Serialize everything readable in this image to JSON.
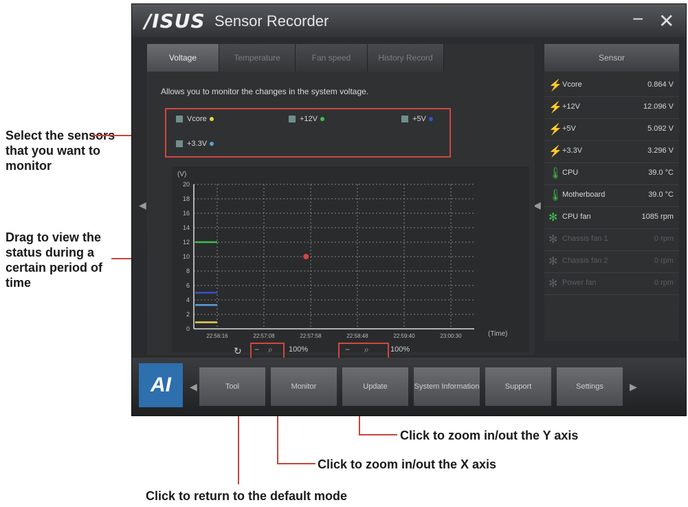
{
  "window": {
    "logo": "/ISUS",
    "title": "Sensor Recorder",
    "minimize": "−",
    "close": "✕"
  },
  "tabs": [
    {
      "label": "Voltage",
      "active": true
    },
    {
      "label": "Temperature",
      "active": false
    },
    {
      "label": "Fan speed",
      "active": false
    },
    {
      "label": "History Record",
      "active": false
    }
  ],
  "description": "Allows you to monitor the changes in the system voltage.",
  "sensor_checks": [
    {
      "label": "Vcore",
      "color": "#e8d24a"
    },
    {
      "label": "+12V",
      "color": "#3fbf4a"
    },
    {
      "label": "+5V",
      "color": "#3355cc"
    },
    {
      "label": "+3.3V",
      "color": "#5aa0d8"
    }
  ],
  "chart_data": {
    "type": "line",
    "ylabel": "(V)",
    "xlabel": "(Time)",
    "ylim": [
      0,
      20
    ],
    "yticks": [
      0,
      2,
      4,
      6,
      8,
      10,
      12,
      14,
      16,
      18,
      20
    ],
    "xticks": [
      "22:56:16",
      "22:57:08",
      "22:57:58",
      "22:58:48",
      "22:59:40",
      "23:00:30"
    ],
    "grid": true,
    "series": [
      {
        "name": "+12V",
        "color": "#3fbf4a",
        "values": [
          12,
          12
        ]
      },
      {
        "name": "+5V",
        "color": "#3355cc",
        "values": [
          5,
          5
        ]
      },
      {
        "name": "+3.3V",
        "color": "#5aa0d8",
        "values": [
          3.3,
          3.3
        ]
      },
      {
        "name": "Vcore",
        "color": "#e8d24a",
        "values": [
          0.9,
          0.9
        ]
      }
    ],
    "marker_value": 10
  },
  "zoom": {
    "reset_icon": "↻",
    "x_zoom_value": "100%",
    "y_zoom_value": "100%"
  },
  "sensor_panel": {
    "header": "Sensor",
    "rows": [
      {
        "name": "Vcore",
        "value": "0.864 V",
        "icon": "⚡",
        "color": "#3fbf4a",
        "dim": false
      },
      {
        "name": "+12V",
        "value": "12.096 V",
        "icon": "⚡",
        "color": "#3fbf4a",
        "dim": false
      },
      {
        "name": "+5V",
        "value": "5.092 V",
        "icon": "⚡",
        "color": "#3fbf4a",
        "dim": false
      },
      {
        "name": "+3.3V",
        "value": "3.296 V",
        "icon": "⚡",
        "color": "#3fbf4a",
        "dim": false
      },
      {
        "name": "CPU",
        "value": "39.0 °C",
        "icon": "🌡",
        "color": "#3fbf4a",
        "dim": false
      },
      {
        "name": "Motherboard",
        "value": "39.0 °C",
        "icon": "🌡",
        "color": "#3fbf4a",
        "dim": false
      },
      {
        "name": "CPU fan",
        "value": "1085 rpm",
        "icon": "✻",
        "color": "#3fbf4a",
        "dim": false
      },
      {
        "name": "Chassis fan 1",
        "value": "0 rpm",
        "icon": "✻",
        "color": "#5c5d60",
        "dim": true
      },
      {
        "name": "Chassis fan 2",
        "value": "0 rpm",
        "icon": "✻",
        "color": "#5c5d60",
        "dim": true
      },
      {
        "name": "Power fan",
        "value": "0 rpm",
        "icon": "✻",
        "color": "#5c5d60",
        "dim": true
      }
    ]
  },
  "bottom_nav": {
    "logo": "AI",
    "items": [
      "Tool",
      "Monitor",
      "Update",
      "System Information",
      "Support",
      "Settings"
    ]
  },
  "callouts": {
    "select": "Select the sensors that you want to monitor",
    "drag": "Drag to view the status during a certain period of time",
    "zoom_y": "Click to zoom in/out the Y axis",
    "zoom_x": "Click to zoom in/out the X axis",
    "default": "Click to return to the default mode"
  }
}
